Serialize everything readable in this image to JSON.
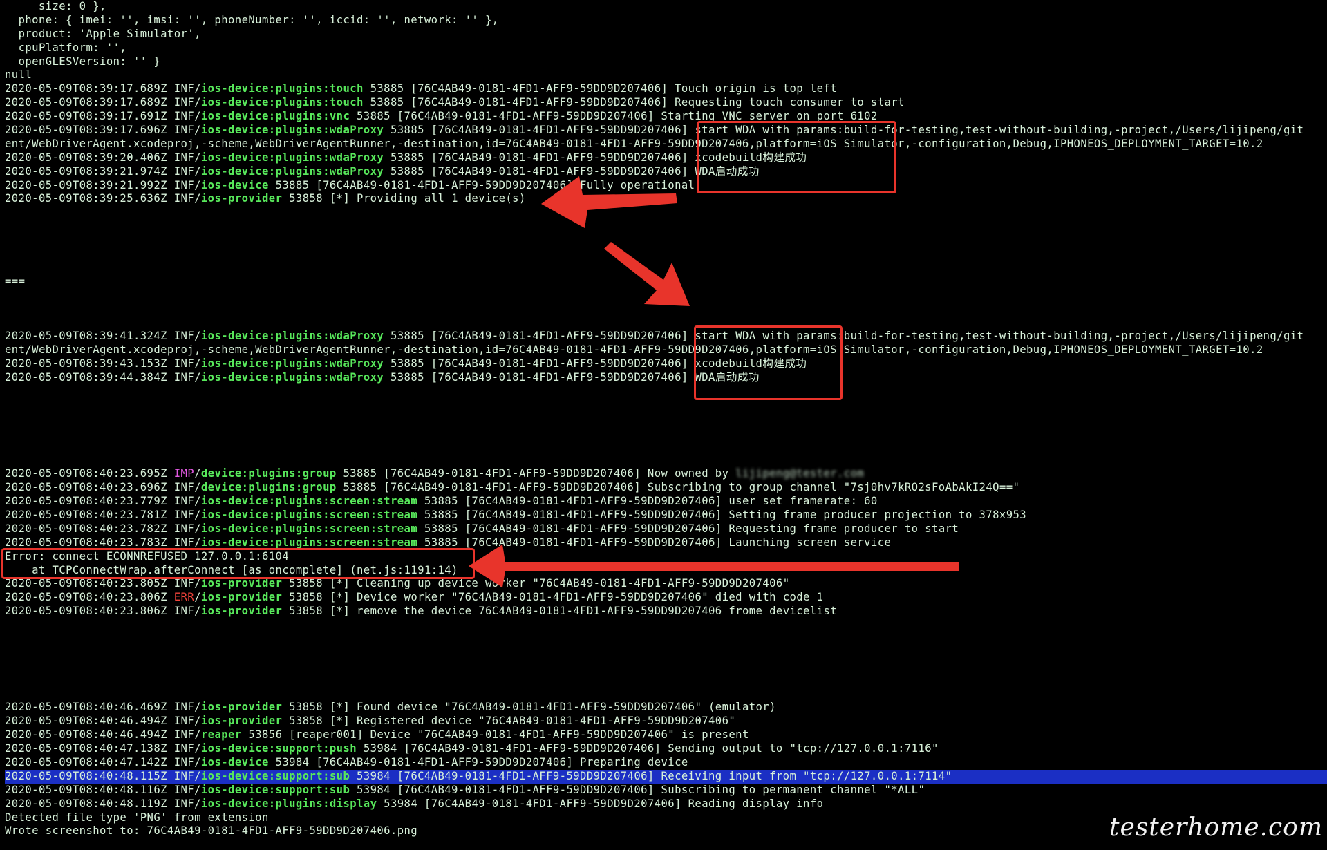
{
  "terminal": {
    "lines": [
      {
        "text": "     size: 0 },"
      },
      {
        "text": "  phone: { imei: '', imsi: '', phoneNumber: '', iccid: '', network: '' },"
      },
      {
        "text": "  product: 'Apple Simulator',"
      },
      {
        "text": "  cpuPlatform: '',"
      },
      {
        "text": "  openGLESVersion: '' }"
      },
      {
        "text": "null"
      },
      {
        "ts": "2020-05-09T08:39:17.689Z",
        "lvl": "INF",
        "tag": "ios-device:plugins:touch",
        "msg": " 53885 [76C4AB49-0181-4FD1-AFF9-59DD9D207406] Touch origin is top left"
      },
      {
        "ts": "2020-05-09T08:39:17.689Z",
        "lvl": "INF",
        "tag": "ios-device:plugins:touch",
        "msg": " 53885 [76C4AB49-0181-4FD1-AFF9-59DD9D207406] Requesting touch consumer to start"
      },
      {
        "ts": "2020-05-09T08:39:17.691Z",
        "lvl": "INF",
        "tag": "ios-device:plugins:vnc",
        "msg": " 53885 [76C4AB49-0181-4FD1-AFF9-59DD9D207406] Starting VNC server on port 6102"
      },
      {
        "ts": "2020-05-09T08:39:17.696Z",
        "lvl": "INF",
        "tag": "ios-device:plugins:wdaProxy",
        "msg": " 53885 [76C4AB49-0181-4FD1-AFF9-59DD9D207406] start WDA with params:build-for-testing,test-without-building,-project,/Users/lijipeng/git"
      },
      {
        "text": "ent/WebDriverAgent.xcodeproj,-scheme,WebDriverAgentRunner,-destination,id=76C4AB49-0181-4FD1-AFF9-59DD9D207406,platform=iOS Simulator,-configuration,Debug,IPHONEOS_DEPLOYMENT_TARGET=10.2"
      },
      {
        "ts": "2020-05-09T08:39:20.406Z",
        "lvl": "INF",
        "tag": "ios-device:plugins:wdaProxy",
        "msg": " 53885 [76C4AB49-0181-4FD1-AFF9-59DD9D207406] xcodebuild构建成功"
      },
      {
        "ts": "2020-05-09T08:39:21.974Z",
        "lvl": "INF",
        "tag": "ios-device:plugins:wdaProxy",
        "msg": " 53885 [76C4AB49-0181-4FD1-AFF9-59DD9D207406] WDA启动成功"
      },
      {
        "ts": "2020-05-09T08:39:21.992Z",
        "lvl": "INF",
        "tag": "ios-device",
        "msg": " 53885 [76C4AB49-0181-4FD1-AFF9-59DD9D207406] Fully operational"
      },
      {
        "ts": "2020-05-09T08:39:25.636Z",
        "lvl": "INF",
        "tag": "ios-provider",
        "msg": " 53858 [*] Providing all 1 device(s)"
      },
      {
        "text": ""
      },
      {
        "text": ""
      },
      {
        "text": ""
      },
      {
        "text": ""
      },
      {
        "text": ""
      },
      {
        "text": "==="
      },
      {
        "text": ""
      },
      {
        "text": ""
      },
      {
        "text": ""
      },
      {
        "ts": "2020-05-09T08:39:41.324Z",
        "lvl": "INF",
        "tag": "ios-device:plugins:wdaProxy",
        "msg": " 53885 [76C4AB49-0181-4FD1-AFF9-59DD9D207406] start WDA with params:build-for-testing,test-without-building,-project,/Users/lijipeng/git"
      },
      {
        "text": "ent/WebDriverAgent.xcodeproj,-scheme,WebDriverAgentRunner,-destination,id=76C4AB49-0181-4FD1-AFF9-59DD9D207406,platform=iOS Simulator,-configuration,Debug,IPHONEOS_DEPLOYMENT_TARGET=10.2"
      },
      {
        "ts": "2020-05-09T08:39:43.153Z",
        "lvl": "INF",
        "tag": "ios-device:plugins:wdaProxy",
        "msg": " 53885 [76C4AB49-0181-4FD1-AFF9-59DD9D207406] xcodebuild构建成功"
      },
      {
        "ts": "2020-05-09T08:39:44.384Z",
        "lvl": "INF",
        "tag": "ios-device:plugins:wdaProxy",
        "msg": " 53885 [76C4AB49-0181-4FD1-AFF9-59DD9D207406] WDA启动成功"
      },
      {
        "text": ""
      },
      {
        "text": ""
      },
      {
        "text": ""
      },
      {
        "text": ""
      },
      {
        "text": ""
      },
      {
        "text": ""
      },
      {
        "ts": "2020-05-09T08:40:23.695Z",
        "lvl": "IMP",
        "tag": "device:plugins:group",
        "msg": " 53885 [76C4AB49-0181-4FD1-AFF9-59DD9D207406] Now owned by ",
        "blur": "lijipeng@tester.com"
      },
      {
        "ts": "2020-05-09T08:40:23.696Z",
        "lvl": "INF",
        "tag": "device:plugins:group",
        "msg": " 53885 [76C4AB49-0181-4FD1-AFF9-59DD9D207406] Subscribing to group channel \"7sj0hv7kRO2sFoAbAkI24Q==\""
      },
      {
        "ts": "2020-05-09T08:40:23.779Z",
        "lvl": "INF",
        "tag": "ios-device:plugins:screen:stream",
        "msg": " 53885 [76C4AB49-0181-4FD1-AFF9-59DD9D207406] user set framerate: 60"
      },
      {
        "ts": "2020-05-09T08:40:23.781Z",
        "lvl": "INF",
        "tag": "ios-device:plugins:screen:stream",
        "msg": " 53885 [76C4AB49-0181-4FD1-AFF9-59DD9D207406] Setting frame producer projection to 378x953"
      },
      {
        "ts": "2020-05-09T08:40:23.782Z",
        "lvl": "INF",
        "tag": "ios-device:plugins:screen:stream",
        "msg": " 53885 [76C4AB49-0181-4FD1-AFF9-59DD9D207406] Requesting frame producer to start"
      },
      {
        "ts": "2020-05-09T08:40:23.783Z",
        "lvl": "INF",
        "tag": "ios-device:plugins:screen:stream",
        "msg": " 53885 [76C4AB49-0181-4FD1-AFF9-59DD9D207406] Launching screen service"
      },
      {
        "text": "Error: connect ECONNREFUSED 127.0.0.1:6104"
      },
      {
        "text": "    at TCPConnectWrap.afterConnect [as oncomplete] (net.js:1191:14)"
      },
      {
        "ts": "2020-05-09T08:40:23.805Z",
        "lvl": "INF",
        "tag": "ios-provider",
        "msg": " 53858 [*] Cleaning up device worker \"76C4AB49-0181-4FD1-AFF9-59DD9D207406\""
      },
      {
        "ts": "2020-05-09T08:40:23.806Z",
        "lvl": "ERR",
        "tag": "ios-provider",
        "msg": " 53858 [*] Device worker \"76C4AB49-0181-4FD1-AFF9-59DD9D207406\" died with code 1"
      },
      {
        "ts": "2020-05-09T08:40:23.806Z",
        "lvl": "INF",
        "tag": "ios-provider",
        "msg": " 53858 [*] remove the device 76C4AB49-0181-4FD1-AFF9-59DD9D207406 frome devicelist"
      },
      {
        "text": ""
      },
      {
        "text": ""
      },
      {
        "text": ""
      },
      {
        "text": ""
      },
      {
        "text": ""
      },
      {
        "text": ""
      },
      {
        "ts": "2020-05-09T08:40:46.469Z",
        "lvl": "INF",
        "tag": "ios-provider",
        "msg": " 53858 [*] Found device \"76C4AB49-0181-4FD1-AFF9-59DD9D207406\" (emulator)"
      },
      {
        "ts": "2020-05-09T08:40:46.494Z",
        "lvl": "INF",
        "tag": "ios-provider",
        "msg": " 53858 [*] Registered device \"76C4AB49-0181-4FD1-AFF9-59DD9D207406\""
      },
      {
        "ts": "2020-05-09T08:40:46.494Z",
        "lvl": "INF",
        "tag": "reaper",
        "msg": " 53856 [reaper001] Device \"76C4AB49-0181-4FD1-AFF9-59DD9D207406\" is present"
      },
      {
        "ts": "2020-05-09T08:40:47.138Z",
        "lvl": "INF",
        "tag": "ios-device:support:push",
        "msg": " 53984 [76C4AB49-0181-4FD1-AFF9-59DD9D207406] Sending output to \"tcp://127.0.0.1:7116\""
      },
      {
        "ts": "2020-05-09T08:40:47.142Z",
        "lvl": "INF",
        "tag": "ios-device",
        "msg": " 53984 [76C4AB49-0181-4FD1-AFF9-59DD9D207406] Preparing device"
      },
      {
        "ts": "2020-05-09T08:40:48.115Z",
        "lvl": "INF",
        "tag": "ios-device:support:sub",
        "msg": " 53984 [76C4AB49-0181-4FD1-AFF9-59DD9D207406] Receiving input from \"tcp://127.0.0.1:7114\"",
        "selected": true
      },
      {
        "ts": "2020-05-09T08:40:48.116Z",
        "lvl": "INF",
        "tag": "ios-device:support:sub",
        "msg": " 53984 [76C4AB49-0181-4FD1-AFF9-59DD9D207406] Subscribing to permanent channel \"*ALL\""
      },
      {
        "ts": "2020-05-09T08:40:48.119Z",
        "lvl": "INF",
        "tag": "ios-device:plugins:display",
        "msg": " 53984 [76C4AB49-0181-4FD1-AFF9-59DD9D207406] Reading display info"
      },
      {
        "text": "Detected file type 'PNG' from extension"
      },
      {
        "text": "Wrote screenshot to: 76C4AB49-0181-4FD1-AFF9-59DD9D207406.png"
      }
    ]
  },
  "watermark": "testerhome.com",
  "colors": {
    "background": "#000000",
    "text": "#d7f0d9",
    "tag": "#58e85b",
    "imp": "#e45ae3",
    "err": "#f0433a",
    "selection": "#1b2fc4",
    "annotation": "#e8342b"
  }
}
